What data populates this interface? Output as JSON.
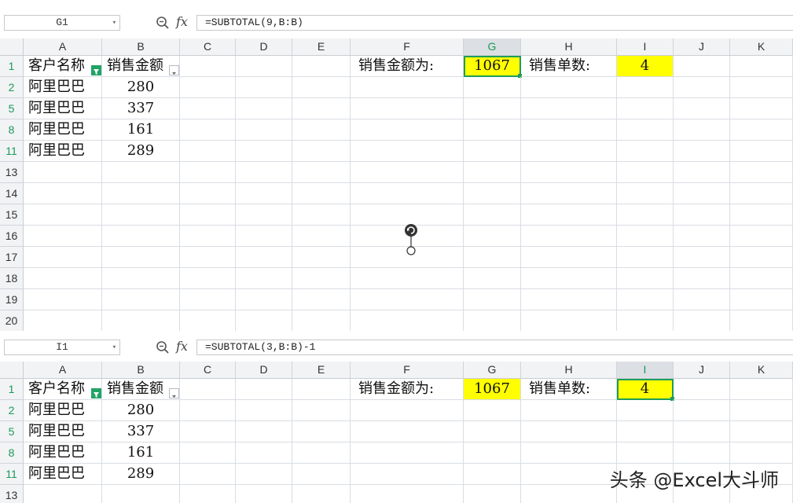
{
  "columns": [
    "A",
    "B",
    "C",
    "D",
    "E",
    "F",
    "G",
    "H",
    "I",
    "J",
    "K"
  ],
  "header_row": {
    "a1": "客户名称",
    "b1": "销售金额",
    "f1": "销售金额为:",
    "g1": "1067",
    "h1": "销售单数:",
    "i1": "4"
  },
  "data_rows": [
    {
      "row": "2",
      "name": "阿里巴巴",
      "amount": "280"
    },
    {
      "row": "5",
      "name": "阿里巴巴",
      "amount": "337"
    },
    {
      "row": "8",
      "name": "阿里巴巴",
      "amount": "161"
    },
    {
      "row": "11",
      "name": "阿里巴巴",
      "amount": "289"
    }
  ],
  "top_pane": {
    "name_box": "G1",
    "formula": "=SUBTOTAL(9,B:B)",
    "selected_column": "G",
    "extra_rows": [
      "13",
      "14",
      "15",
      "16",
      "17",
      "18",
      "19",
      "20"
    ]
  },
  "bottom_pane": {
    "name_box": "I1",
    "formula": "=SUBTOTAL(3,B:B)-1",
    "selected_column": "I",
    "extra_rows": [
      "13"
    ]
  },
  "colors": {
    "highlight_fill": "#ffff00",
    "selection_green": "#1e9c5a",
    "filter_active": "#21a366"
  },
  "icons": [
    "zoom-icon",
    "fx-icon",
    "filter-active-icon",
    "filter-dropdown-icon",
    "rotate-handle-icon"
  ],
  "watermark": "头条 @Excel大斗师"
}
